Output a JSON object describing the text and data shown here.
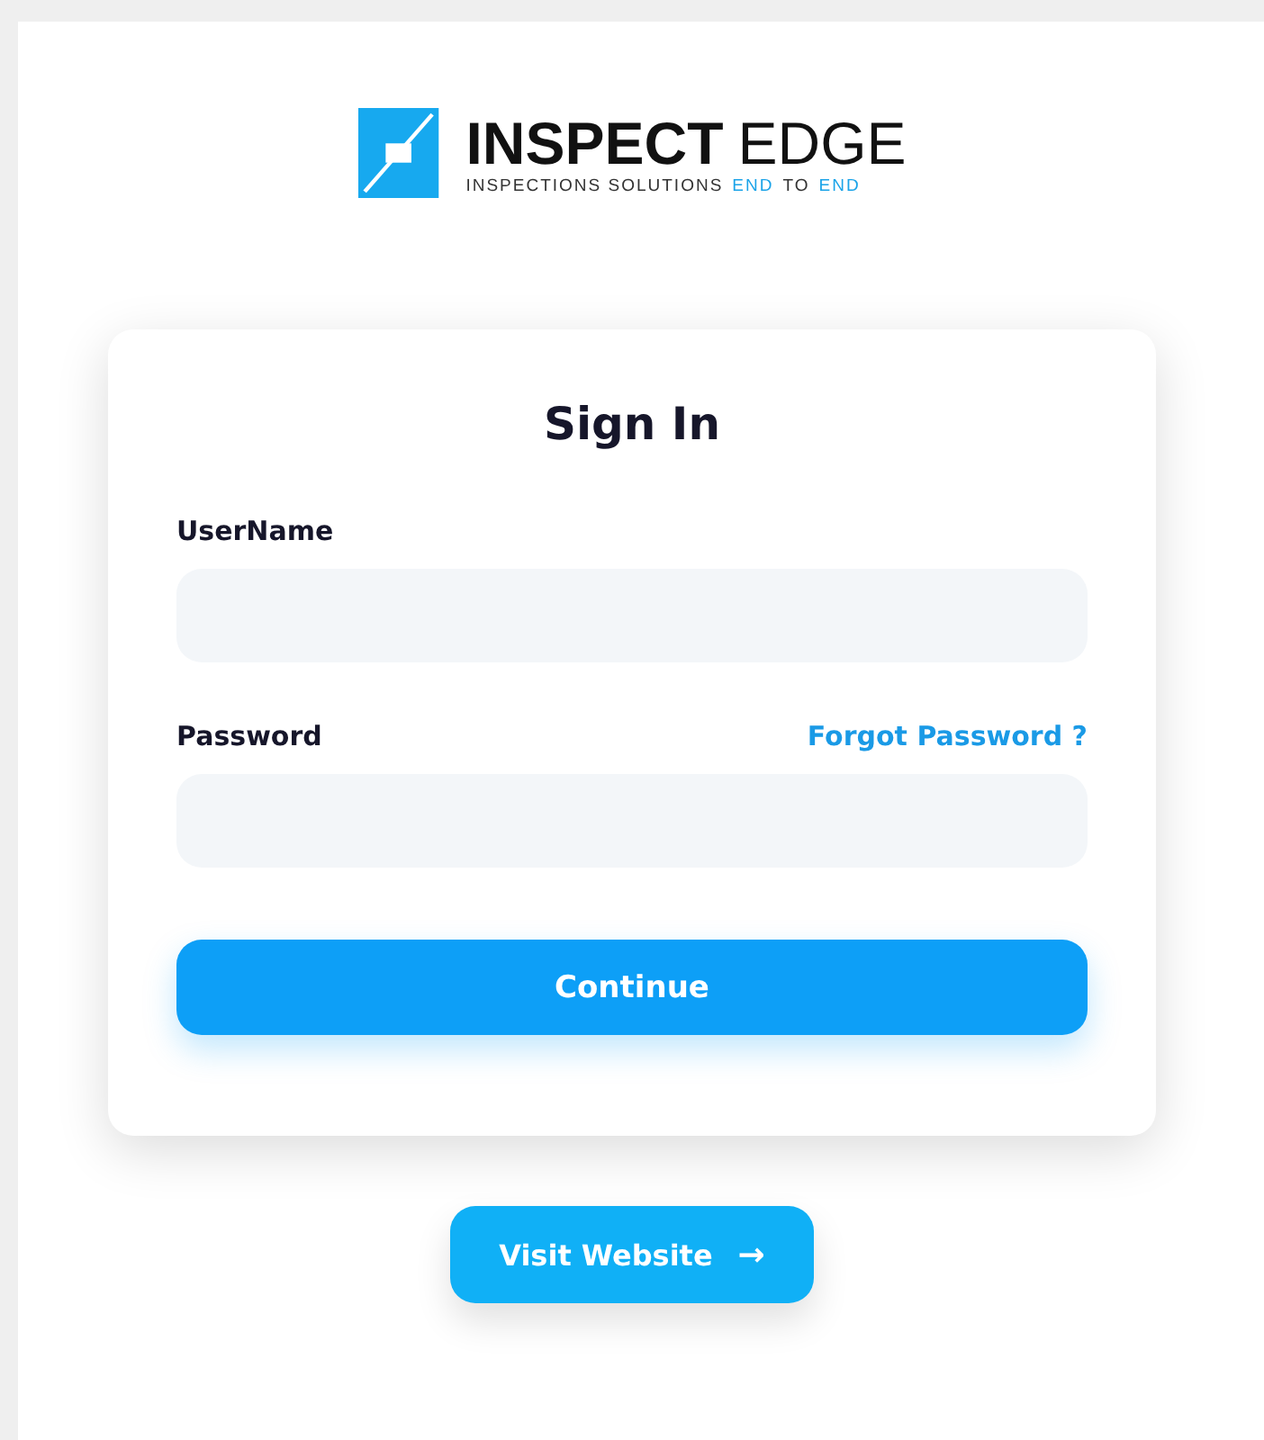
{
  "logo": {
    "wordmark": [
      {
        "text": "INSPECT",
        "bold": true
      },
      {
        "text": "EDGE",
        "bold": false
      }
    ],
    "tagline": [
      {
        "text": "INSPECTIONS SOLUTIONS",
        "highlight": false
      },
      {
        "text": "END",
        "highlight": true
      },
      {
        "text": "TO",
        "highlight": false
      },
      {
        "text": "END",
        "highlight": true
      }
    ]
  },
  "card": {
    "title": "Sign In",
    "fields": [
      {
        "label": "UserName"
      },
      {
        "label": "Password",
        "link": "Forgot Password ?"
      }
    ],
    "submit": "Continue"
  },
  "visit_button": {
    "label": "Visit Website",
    "icon": "→"
  }
}
